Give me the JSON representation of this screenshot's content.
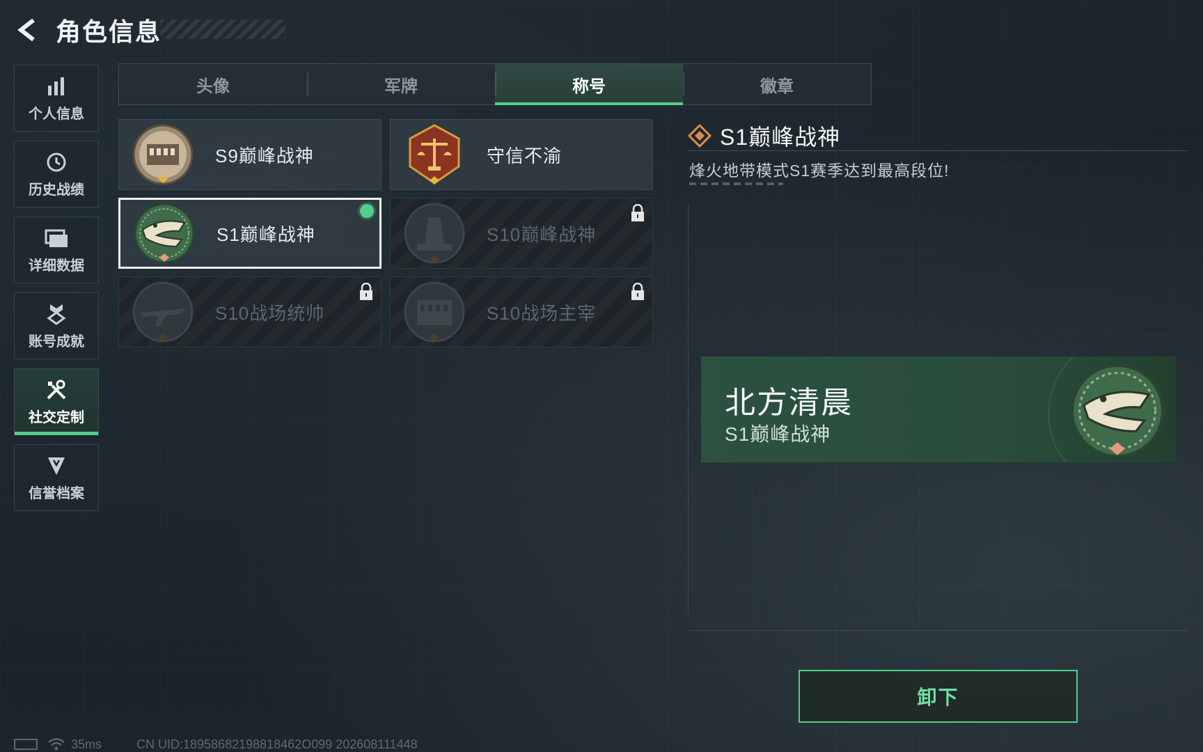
{
  "header": {
    "title": "角色信息"
  },
  "sidebar": {
    "items": [
      {
        "label": "个人信息",
        "icon": "bar-chart-icon"
      },
      {
        "label": "历史战绩",
        "icon": "history-clock-icon"
      },
      {
        "label": "详细数据",
        "icon": "folders-icon"
      },
      {
        "label": "账号成就",
        "icon": "medal-icon"
      },
      {
        "label": "社交定制",
        "icon": "tools-icon",
        "active": true
      },
      {
        "label": "信誉档案",
        "icon": "shield-badge-icon"
      }
    ]
  },
  "tabs": [
    {
      "label": "头像"
    },
    {
      "label": "军牌"
    },
    {
      "label": "称号",
      "active": true
    },
    {
      "label": "徽章"
    }
  ],
  "titles": [
    {
      "name": "S9巅峰战神",
      "locked": false,
      "emblem": "colosseum-emblem"
    },
    {
      "name": "守信不渝",
      "locked": false,
      "emblem": "scales-emblem"
    },
    {
      "name": "S1巅峰战神",
      "locked": false,
      "selected": true,
      "equipped": true,
      "emblem": "crocodile-emblem"
    },
    {
      "name": "S10巅峰战神",
      "locked": true,
      "emblem": "tower-emblem"
    },
    {
      "name": "S10战场统帅",
      "locked": true,
      "emblem": "aircraft-emblem"
    },
    {
      "name": "S10战场主宰",
      "locked": true,
      "emblem": "colosseum-emblem"
    }
  ],
  "detail": {
    "title": "S1巅峰战神",
    "description": "烽火地带模式S1赛季达到最高段位!"
  },
  "preview": {
    "player_name": "北方清晨",
    "title": "S1巅峰战神"
  },
  "unequip_label": "卸下",
  "status": {
    "ping": "35ms",
    "uid": "CN UID:18958682198818462O099 202608111448"
  },
  "colors": {
    "accent": "#4fd08f",
    "preview_bg": "#2c5140",
    "emblem_green": "#3f6b4a",
    "emblem_red": "#8a3421"
  }
}
